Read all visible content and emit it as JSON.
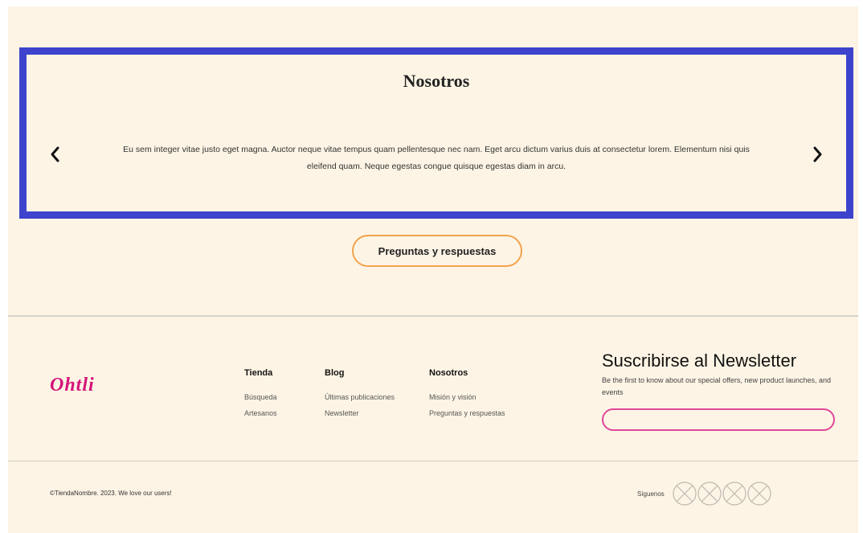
{
  "carousel": {
    "title": "Nosotros",
    "text": "Eu sem integer vitae justo eget magna. Auctor neque vitae tempus quam pellentesque nec nam. Eget arcu dictum varius duis at consectetur lorem. Elementum nisi quis eleifend quam. Neque egestas congue quisque egestas diam in arcu.",
    "prev_icon": "chevron-left-icon",
    "next_icon": "chevron-right-icon",
    "border_color": "#3d43cc"
  },
  "faq_button": {
    "label": "Preguntas y respuestas",
    "border_color": "#f3a24b"
  },
  "footer": {
    "logo": "Ohtli",
    "logo_color": "#d4147a",
    "columns": [
      {
        "heading": "Tienda",
        "links": [
          "Búsqueda",
          "Artesanos"
        ]
      },
      {
        "heading": "Blog",
        "links": [
          "Últimas publicaciones",
          "Newsletter"
        ]
      },
      {
        "heading": "Nosotros",
        "links": [
          "Misión y visión",
          "Preguntas y respuestas"
        ]
      }
    ],
    "newsletter": {
      "title": "Suscribirse al  Newsletter",
      "description": "Be the first to know about our special offers, new product launches, and events",
      "input_value": "",
      "input_border_color": "#e0479a"
    },
    "copyright": "©TiendaNombre. 2023. We love our users!",
    "social": {
      "label": "Síguenos",
      "icons": [
        "social-icon-placeholder",
        "social-icon-placeholder",
        "social-icon-placeholder",
        "social-icon-placeholder"
      ]
    }
  },
  "colors": {
    "background": "#fdf4e5"
  }
}
